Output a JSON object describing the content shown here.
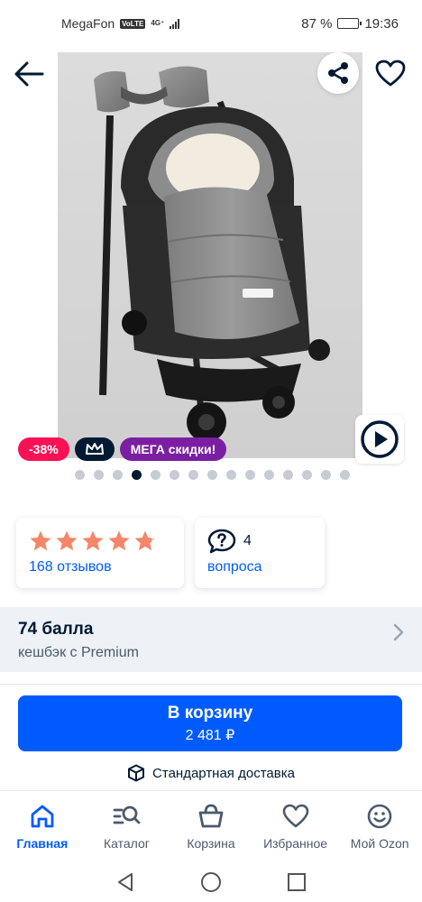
{
  "status_bar": {
    "carrier": "MegaFon",
    "volte": "VoLTE",
    "network": "4G⁺",
    "battery_text": "87 %",
    "battery_level": 0.87,
    "time": "19:36"
  },
  "product": {
    "icons": {
      "back": "arrow-left-icon",
      "share": "share-icon",
      "favorite": "heart-icon",
      "play": "play-icon"
    },
    "badges": {
      "discount": "-38%",
      "premium_icon": "crown-icon",
      "mega": "МЕГА скидки!"
    },
    "gallery": {
      "total": 15,
      "active_index": 3
    }
  },
  "reviews": {
    "rating": 4.8,
    "max_rating": 5,
    "star_color": "#f6866a",
    "link": "168 отзывов"
  },
  "questions": {
    "count": "4",
    "link": "вопроса",
    "icon": "question-bubble-icon"
  },
  "cashback": {
    "title": "74 балла",
    "subtitle": "кешбэк с Premium"
  },
  "cart": {
    "button_label": "В корзину",
    "price": "2 481 ₽",
    "delivery": "Стандартная доставка",
    "accent": "#005bff"
  },
  "bottom_nav": {
    "items": [
      {
        "label": "Главная",
        "icon": "home-icon"
      },
      {
        "label": "Каталог",
        "icon": "catalog-search-icon"
      },
      {
        "label": "Корзина",
        "icon": "basket-icon"
      },
      {
        "label": "Избранное",
        "icon": "heart-icon"
      },
      {
        "label": "Мой Ozon",
        "icon": "smile-icon"
      }
    ]
  }
}
